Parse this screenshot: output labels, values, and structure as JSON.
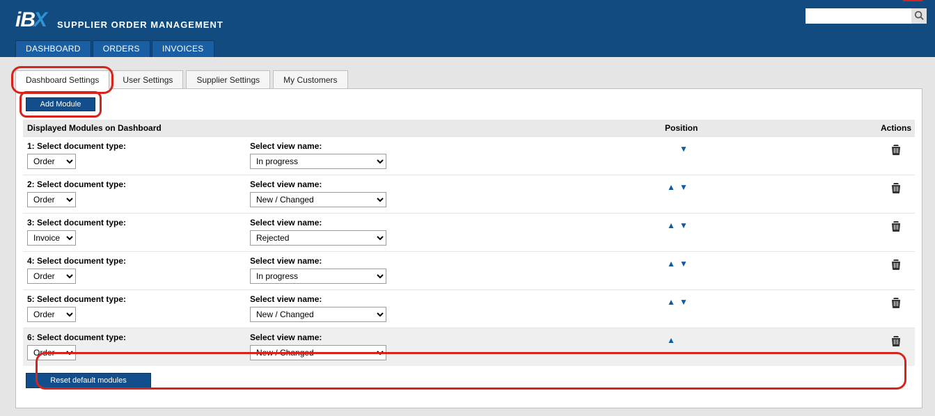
{
  "app": {
    "logo_ib": "iB",
    "logo_x": "X",
    "title": "SUPPLIER ORDER MANAGEMENT"
  },
  "search": {
    "value": "",
    "placeholder": ""
  },
  "mainnav": [
    {
      "label": "DASHBOARD",
      "active": true
    },
    {
      "label": "ORDERS",
      "active": false
    },
    {
      "label": "INVOICES",
      "active": false
    }
  ],
  "subtabs": [
    {
      "label": "Dashboard Settings",
      "active": true,
      "highlighted": true
    },
    {
      "label": "User Settings",
      "active": false,
      "highlighted": false
    },
    {
      "label": "Supplier Settings",
      "active": false,
      "highlighted": false
    },
    {
      "label": "My Customers",
      "active": false,
      "highlighted": false
    }
  ],
  "buttons": {
    "add_module": "Add Module",
    "reset_default": "Reset default modules"
  },
  "table": {
    "header_modules": "Displayed Modules on Dashboard",
    "header_position": "Position",
    "header_actions": "Actions",
    "doc_label_tpl": "Select document type:",
    "view_label": "Select view name:"
  },
  "rows": [
    {
      "idx": "1",
      "doc": "Order",
      "view": "In progress",
      "up": false,
      "down": true,
      "highlighted": false
    },
    {
      "idx": "2",
      "doc": "Order",
      "view": "New / Changed",
      "up": true,
      "down": true,
      "highlighted": false
    },
    {
      "idx": "3",
      "doc": "Invoice",
      "view": "Rejected",
      "up": true,
      "down": true,
      "highlighted": false
    },
    {
      "idx": "4",
      "doc": "Order",
      "view": "In progress",
      "up": true,
      "down": true,
      "highlighted": false
    },
    {
      "idx": "5",
      "doc": "Order",
      "view": "New / Changed",
      "up": true,
      "down": true,
      "highlighted": false
    },
    {
      "idx": "6",
      "doc": "Order",
      "view": "New / Changed",
      "up": true,
      "down": false,
      "highlighted": true
    }
  ],
  "doc_options": [
    "Order",
    "Invoice"
  ],
  "view_options": [
    "In progress",
    "New / Changed",
    "Rejected"
  ]
}
